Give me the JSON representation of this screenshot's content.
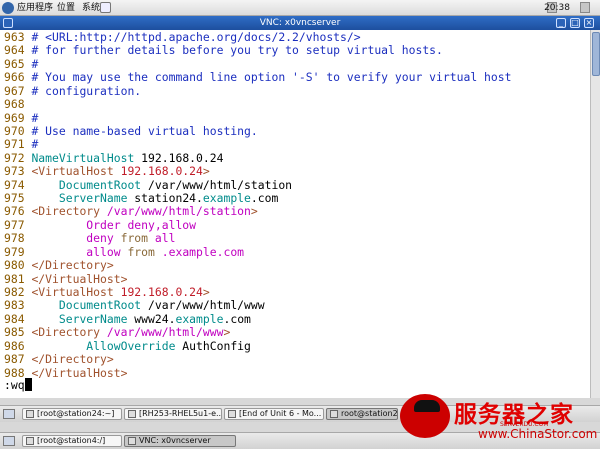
{
  "top_panel": {
    "menus": [
      "应用程序",
      "位置",
      "系统"
    ],
    "clock": "20:38"
  },
  "vnc_window": {
    "title": "VNC: x0vncserver",
    "buttons": [
      "_",
      "□",
      "×"
    ]
  },
  "terminal": {
    "lines": [
      {
        "num": "963",
        "segs": [
          {
            "t": "# <URL:http://httpd.apache.org/docs/2.2/vhosts/>",
            "c": "c"
          }
        ]
      },
      {
        "num": "964",
        "segs": [
          {
            "t": "# for further details before you try to setup virtual hosts.",
            "c": "c"
          }
        ]
      },
      {
        "num": "965",
        "segs": [
          {
            "t": "#",
            "c": "c"
          }
        ]
      },
      {
        "num": "966",
        "segs": [
          {
            "t": "# You may use the command line option '-S' to verify your virtual host",
            "c": "c"
          }
        ]
      },
      {
        "num": "967",
        "segs": [
          {
            "t": "# configuration.",
            "c": "c"
          }
        ]
      },
      {
        "num": "968",
        "segs": []
      },
      {
        "num": "969",
        "segs": [
          {
            "t": "#",
            "c": "c"
          }
        ]
      },
      {
        "num": "970",
        "segs": [
          {
            "t": "# Use name-based virtual hosting.",
            "c": "c"
          }
        ]
      },
      {
        "num": "971",
        "segs": [
          {
            "t": "#",
            "c": "c"
          }
        ]
      },
      {
        "num": "972",
        "segs": [
          {
            "t": "NameVirtualHost",
            "c": "d"
          },
          {
            "t": " 192.168.0.24",
            "c": ""
          }
        ]
      },
      {
        "num": "973",
        "segs": [
          {
            "t": "<VirtualHost",
            "c": "t"
          },
          {
            "t": " 192.168.0.24",
            "c": "r"
          },
          {
            "t": ">",
            "c": "t"
          }
        ]
      },
      {
        "num": "974",
        "segs": [
          {
            "t": "    DocumentRoot",
            "c": "d"
          },
          {
            "t": " /var/www/html/station",
            "c": ""
          }
        ]
      },
      {
        "num": "975",
        "segs": [
          {
            "t": "    ServerName",
            "c": "d"
          },
          {
            "t": " station24.",
            "c": ""
          },
          {
            "t": "example",
            "c": "d"
          },
          {
            "t": ".com",
            "c": ""
          }
        ]
      },
      {
        "num": "976",
        "segs": [
          {
            "t": "<Directory",
            "c": "t"
          },
          {
            "t": " /var/www/html/station",
            "c": "m"
          },
          {
            "t": ">",
            "c": "t"
          }
        ]
      },
      {
        "num": "977",
        "segs": [
          {
            "t": "        Order deny,allow",
            "c": "m"
          }
        ]
      },
      {
        "num": "978",
        "segs": [
          {
            "t": "        deny ",
            "c": "m"
          },
          {
            "t": "from",
            "c": "k"
          },
          {
            "t": " all",
            "c": "m"
          }
        ]
      },
      {
        "num": "979",
        "segs": [
          {
            "t": "        allow ",
            "c": "m"
          },
          {
            "t": "from",
            "c": "k"
          },
          {
            "t": " .example.com",
            "c": "m"
          }
        ]
      },
      {
        "num": "980",
        "segs": [
          {
            "t": "</Directory>",
            "c": "t"
          }
        ]
      },
      {
        "num": "981",
        "segs": [
          {
            "t": "</VirtualHost>",
            "c": "t"
          }
        ]
      },
      {
        "num": "982",
        "segs": [
          {
            "t": "<VirtualHost",
            "c": "t"
          },
          {
            "t": " 192.168.0.24",
            "c": "r"
          },
          {
            "t": ">",
            "c": "t"
          }
        ]
      },
      {
        "num": "983",
        "segs": [
          {
            "t": "    DocumentRoot",
            "c": "d"
          },
          {
            "t": " /var/www/html/www",
            "c": ""
          }
        ]
      },
      {
        "num": "984",
        "segs": [
          {
            "t": "    ServerName",
            "c": "d"
          },
          {
            "t": " www24.",
            "c": ""
          },
          {
            "t": "example",
            "c": "d"
          },
          {
            "t": ".com",
            "c": ""
          }
        ]
      },
      {
        "num": "985",
        "segs": [
          {
            "t": "<Directory",
            "c": "t"
          },
          {
            "t": " /var/www/html/www",
            "c": "m"
          },
          {
            "t": ">",
            "c": "t"
          }
        ]
      },
      {
        "num": "986",
        "segs": [
          {
            "t": "        AllowOverride",
            "c": "d"
          },
          {
            "t": " AuthConfig",
            "c": ""
          }
        ]
      },
      {
        "num": "987",
        "segs": [
          {
            "t": "</Directory>",
            "c": "t"
          }
        ]
      },
      {
        "num": "988",
        "segs": [
          {
            "t": "</VirtualHost>",
            "c": "t"
          }
        ]
      }
    ],
    "command": ":wq"
  },
  "taskbar_vnc": {
    "tasks": [
      "[root@station24:~]",
      "[RH253-RHEL5u1-e...",
      "[End of Unit 6 - Mo...",
      "root@station24"
    ]
  },
  "taskbar_host": {
    "tasks": [
      "[root@station4:/]",
      "VNC: x0vncserver"
    ]
  },
  "watermark": {
    "brand": "服务器之家",
    "url": "www.ChinaStor.com",
    "small": "SERVERDU.COM"
  }
}
